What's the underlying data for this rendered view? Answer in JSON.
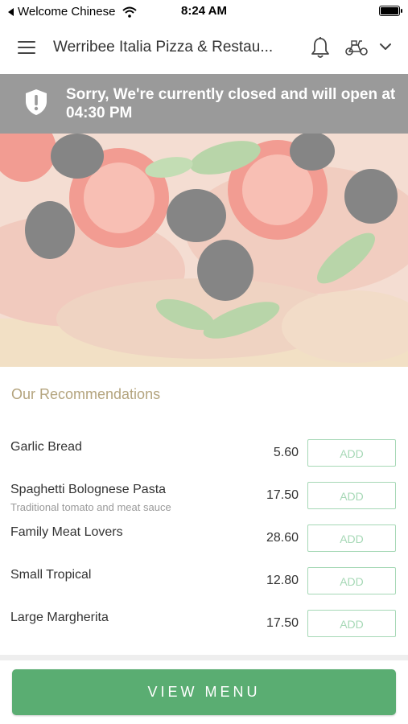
{
  "status_bar": {
    "back_label": "Welcome Chinese",
    "time": "8:24 AM",
    "icons": [
      "back-triangle-icon",
      "wifi-icon",
      "battery-icon"
    ]
  },
  "header": {
    "title": "Werribee Italia Pizza & Restau...",
    "icons": [
      "menu-icon",
      "bell-icon",
      "scooter-icon",
      "chevron-down-icon"
    ]
  },
  "banner": {
    "icon": "shield-exclamation-icon",
    "message": "Sorry, We're currently closed and will open at 04:30 PM"
  },
  "recommendations": {
    "title": "Our Recommendations",
    "items": [
      {
        "name": "Garlic Bread",
        "description": "",
        "price": "5.60",
        "action": "ADD"
      },
      {
        "name": "Spaghetti Bolognese Pasta",
        "description": "Traditional tomato and meat sauce",
        "price": "17.50",
        "action": "ADD"
      },
      {
        "name": "Family Meat Lovers",
        "description": "",
        "price": "28.60",
        "action": "ADD"
      },
      {
        "name": "Small Tropical",
        "description": "",
        "price": "12.80",
        "action": "ADD"
      },
      {
        "name": "Large Margherita",
        "description": "",
        "price": "17.50",
        "action": "ADD"
      }
    ]
  },
  "footer": {
    "view_menu_label": "VIEW MENU"
  },
  "colors": {
    "banner_bg": "#9a9a9a",
    "accent_green": "#5aad72",
    "add_border": "#a6d8b6",
    "section_title": "#b4a47e"
  }
}
